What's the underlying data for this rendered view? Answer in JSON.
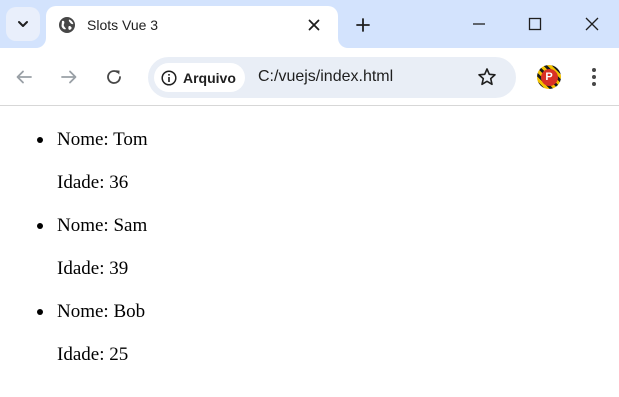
{
  "browser": {
    "tab": {
      "title": "Slots Vue 3"
    },
    "toolbar": {
      "security_chip_label": "Arquivo",
      "url": "C:/vuejs/index.html",
      "profile_initial": "P"
    },
    "icons": {
      "tab_search": "chevron-down-icon",
      "favicon": "globe-icon",
      "tab_close": "close-icon",
      "new_tab": "plus-icon",
      "back": "arrow-left-icon",
      "forward": "arrow-right-icon",
      "reload": "reload-icon",
      "site_info": "info-icon",
      "bookmark": "star-icon",
      "menu": "kebab-menu-icon"
    },
    "colors": {
      "tab_strip": "#d3e3fd",
      "omnibox": "#e9eef6",
      "avatar": "#d93025"
    }
  },
  "page": {
    "people": [
      {
        "nome": "Nome: Tom",
        "idade": "Idade: 36"
      },
      {
        "nome": "Nome: Sam",
        "idade": "Idade: 39"
      },
      {
        "nome": "Nome: Bob",
        "idade": "Idade: 25"
      }
    ]
  }
}
